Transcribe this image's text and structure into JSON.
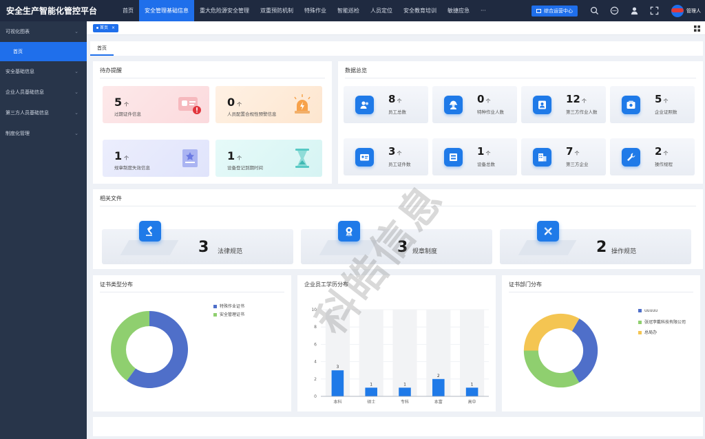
{
  "app": {
    "title": "安全生产智能化管控平台",
    "top_nav": [
      "首页",
      "安全管理基础信息",
      "重大危险源安全管理",
      "双重预防机制",
      "特殊作业",
      "智能巡检",
      "人员定位",
      "安全教育培训",
      "敏捷应急",
      "···"
    ],
    "active_top_nav": "安全管理基础信息",
    "ops_center_label": "综合运营中心",
    "user_name": "管理人",
    "accent": "#1f6feb"
  },
  "sidebar": {
    "items": [
      {
        "label": "可视化图表"
      },
      {
        "label": "安全基础信息"
      },
      {
        "label": "企业人员基础信息"
      },
      {
        "label": "第三方人员基础信息"
      },
      {
        "label": "制度化管理"
      }
    ],
    "active_sub": "首页"
  },
  "tabs": {
    "open_tab": "首页",
    "page_tab": "首页"
  },
  "todo": {
    "title": "待办提醒",
    "cards": [
      {
        "value": "5",
        "unit": "个",
        "label": "过期证件信息"
      },
      {
        "value": "0",
        "unit": "个",
        "label": "人员配置合规性预警信息"
      },
      {
        "value": "1",
        "unit": "个",
        "label": "规章制度失效信息"
      },
      {
        "value": "1",
        "unit": "个",
        "label": "设备登记到期时间"
      }
    ]
  },
  "overview": {
    "title": "数据总览",
    "cards": [
      {
        "value": "8",
        "unit": "个",
        "label": "员工总数",
        "icon": "users-icon"
      },
      {
        "value": "0",
        "unit": "个",
        "label": "特种作业人数",
        "icon": "worker-icon"
      },
      {
        "value": "12",
        "unit": "个",
        "label": "第三方作业人数",
        "icon": "id-person-icon"
      },
      {
        "value": "5",
        "unit": "个",
        "label": "企业证照数",
        "icon": "license-icon"
      },
      {
        "value": "3",
        "unit": "个",
        "label": "员工证件数",
        "icon": "id-card-icon"
      },
      {
        "value": "1",
        "unit": "个",
        "label": "设备总数",
        "icon": "device-icon"
      },
      {
        "value": "7",
        "unit": "个",
        "label": "第三方企业",
        "icon": "building-icon"
      },
      {
        "value": "2",
        "unit": "个",
        "label": "操作规程",
        "icon": "wrench-icon"
      }
    ]
  },
  "documents": {
    "title": "相关文件",
    "cards": [
      {
        "value": "3",
        "label": "法律规范",
        "icon": "gavel-icon"
      },
      {
        "value": "3",
        "label": "规章制度",
        "icon": "award-icon"
      },
      {
        "value": "2",
        "label": "操作规范",
        "icon": "tools-icon"
      }
    ]
  },
  "charts": {
    "cert_type": {
      "title": "证书类型分布",
      "legend": [
        "特殊作业证书",
        "安全管理证书"
      ]
    },
    "education": {
      "title": "企业员工学历分布"
    },
    "cert_dept": {
      "title": "证书部门分布",
      "legend": [
        "uuuuu",
        "张冠李戴科技有限公司",
        "总局办"
      ]
    }
  },
  "chart_data": [
    {
      "type": "pie",
      "title": "证书类型分布",
      "categories": [
        "特殊作业证书",
        "安全管理证书"
      ],
      "values": [
        3,
        2
      ],
      "colors": [
        "#4f6fc9",
        "#8fcf6f"
      ],
      "legend": "top-right"
    },
    {
      "type": "bar",
      "title": "企业员工学历分布",
      "categories": [
        "本科",
        "硕士",
        "专科",
        "本富",
        "高中"
      ],
      "values": [
        3,
        1,
        1,
        2,
        1
      ],
      "ylim": [
        0,
        10
      ],
      "yticks": [
        0,
        2,
        4,
        6,
        8,
        10
      ],
      "color": "#1f7ae8",
      "grid": true
    },
    {
      "type": "pie",
      "title": "证书部门分布",
      "categories": [
        "uuuuu",
        "张冠李戴科技有限公司",
        "总局办"
      ],
      "values": [
        1,
        1,
        1
      ],
      "colors": [
        "#4f6fc9",
        "#8fcf6f",
        "#f4c552"
      ],
      "legend": "top-right"
    }
  ],
  "watermark": "科皓信息"
}
